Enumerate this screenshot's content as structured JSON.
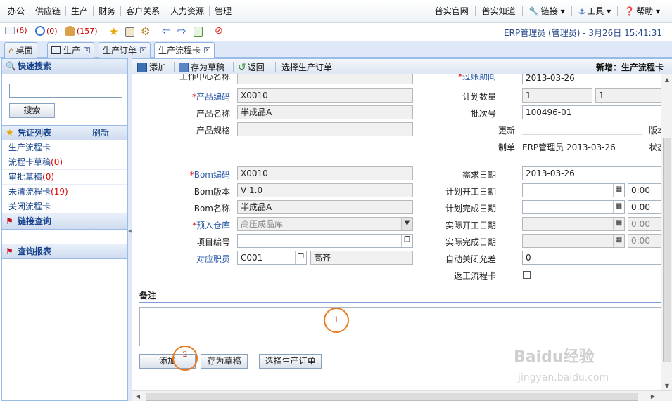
{
  "topmenu": [
    "办公",
    "供应链",
    "生产",
    "财务",
    "客户关系",
    "人力资源",
    "管理"
  ],
  "rightmenu": [
    "普实官网",
    "普实知道",
    "链接 ▾",
    "工具 ▾",
    "帮助 ▾"
  ],
  "toolbar2": {
    "mail": "(6)",
    "clock": "(0)",
    "users": "(157)",
    "user_info": "ERP管理员 (管理员) - 3月26日 15:41:31"
  },
  "tabs": [
    "桌面",
    "生产",
    "生产订单",
    "生产流程卡"
  ],
  "sidebar": {
    "quick_search": "快速搜索",
    "search_button": "搜索",
    "voucher_list": "凭证列表",
    "refresh": "刷新",
    "items": [
      {
        "label": "生产流程卡",
        "count": ""
      },
      {
        "label": "流程卡草稿",
        "count": "(0)"
      },
      {
        "label": "审批草稿",
        "count": "(0)"
      },
      {
        "label": "未清流程卡",
        "count": "(19)"
      },
      {
        "label": "关闭流程卡",
        "count": ""
      }
    ],
    "link_query": "链接查询",
    "query_report": "查询报表"
  },
  "main_toolbar": {
    "add": "添加",
    "save_draft": "存为草稿",
    "back": "返回",
    "select_order": "选择生产订单",
    "mode": "新增：生产流程卡"
  },
  "form": {
    "work_center_label": "工作中心名称",
    "product_code_label": "产品编码",
    "product_code": "X0010",
    "product_name_label": "产品名称",
    "product_name": "半成品A",
    "product_spec_label": "产品规格",
    "bom_code_label": "Bom编码",
    "bom_code": "X0010",
    "bom_version_label": "Bom版本",
    "bom_version": "V 1.0",
    "bom_name_label": "Bom名称",
    "bom_name": "半成品A",
    "warehouse_label": "预入仓库",
    "warehouse": "高压成品库",
    "project_label": "项目编号",
    "staff_label": "对应职员",
    "staff_code": "C001",
    "staff_name": "高齐",
    "post_date_label": "过账期间",
    "post_date": "2013-03-26",
    "plan_qty_label": "计划数量",
    "plan_qty": "1",
    "plan_qty2": "1",
    "batch_label": "批次号",
    "batch": "100496-01",
    "update_label": "更新",
    "version_label": "版本",
    "creator_label": "制单",
    "creator": "ERP管理员 2013-03-26",
    "status_label": "状态",
    "demand_date_label": "需求日期",
    "demand_date": "2013-03-26",
    "plan_start_label": "计划开工日期",
    "plan_start_time": "0:00",
    "plan_finish_label": "计划完成日期",
    "plan_finish_time": "0:00",
    "actual_start_label": "实际开工日期",
    "actual_start_time": "0:00",
    "actual_finish_label": "实际完成日期",
    "actual_finish_time": "0:00",
    "auto_close_label": "自动关闭允差",
    "auto_close": "0",
    "rework_label": "返工流程卡"
  },
  "remark": {
    "label": "备注",
    "marker1": "1",
    "marker2": "2"
  },
  "bottom_buttons": {
    "add": "添加",
    "save_draft": "存为草稿",
    "select_order": "选择生产订单"
  },
  "watermark": {
    "line1": "Baidu经验",
    "line2": "jingyan.baidu.com"
  }
}
